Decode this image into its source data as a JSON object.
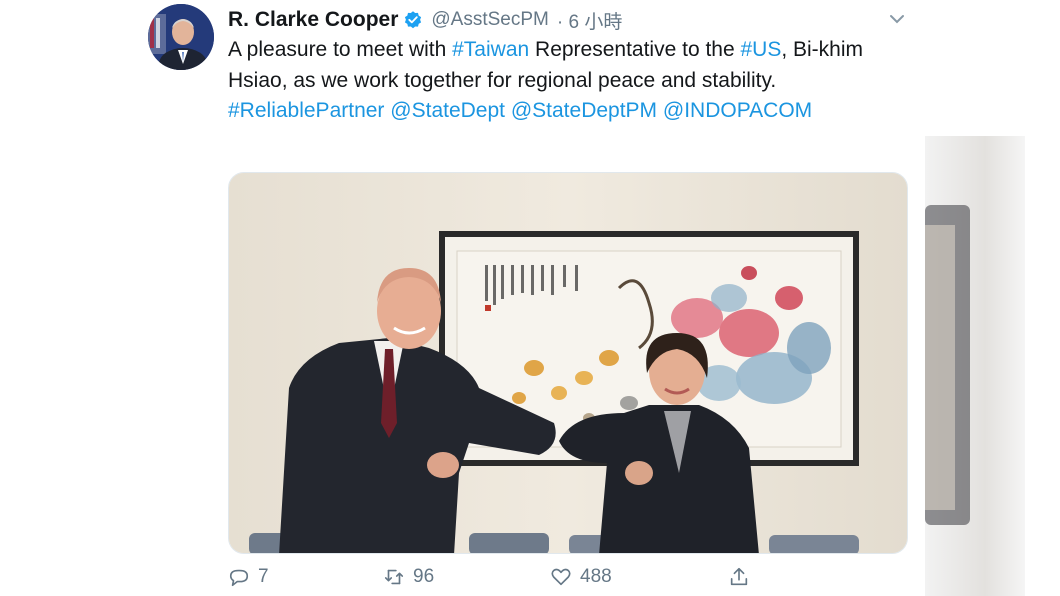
{
  "tweet": {
    "author": {
      "name": "R. Clarke Cooper",
      "handle": "@AsstSecPM",
      "time": "· 6 小時",
      "verified": true
    },
    "text": [
      {
        "t": "A pleasure to meet with ",
        "link": false
      },
      {
        "t": "#Taiwan",
        "link": true
      },
      {
        "t": " Representative to the ",
        "link": false
      },
      {
        "t": "#US",
        "link": true
      },
      {
        "t": ", Bi-khim Hsiao, as we work together for regional peace and stability.  ",
        "link": false
      },
      {
        "t": "#ReliablePartner",
        "link": true
      },
      {
        "t": " ",
        "link": false
      },
      {
        "t": "@StateDept",
        "link": true
      },
      {
        "t": " ",
        "link": false
      },
      {
        "t": "@StateDeptPM",
        "link": true
      },
      {
        "t": " ",
        "link": false
      },
      {
        "t": "@INDOPACOM",
        "link": true
      }
    ],
    "stats": {
      "replies": "7",
      "retweets": "96",
      "likes": "488"
    }
  },
  "icons": {
    "verified": "verified-badge-icon",
    "caret": "chevron-down-icon",
    "reply": "reply-icon",
    "retweet": "retweet-icon",
    "like": "heart-icon",
    "share": "share-icon"
  },
  "colors": {
    "link": "#1b95e0",
    "muted": "#657786",
    "text": "#14171a"
  }
}
